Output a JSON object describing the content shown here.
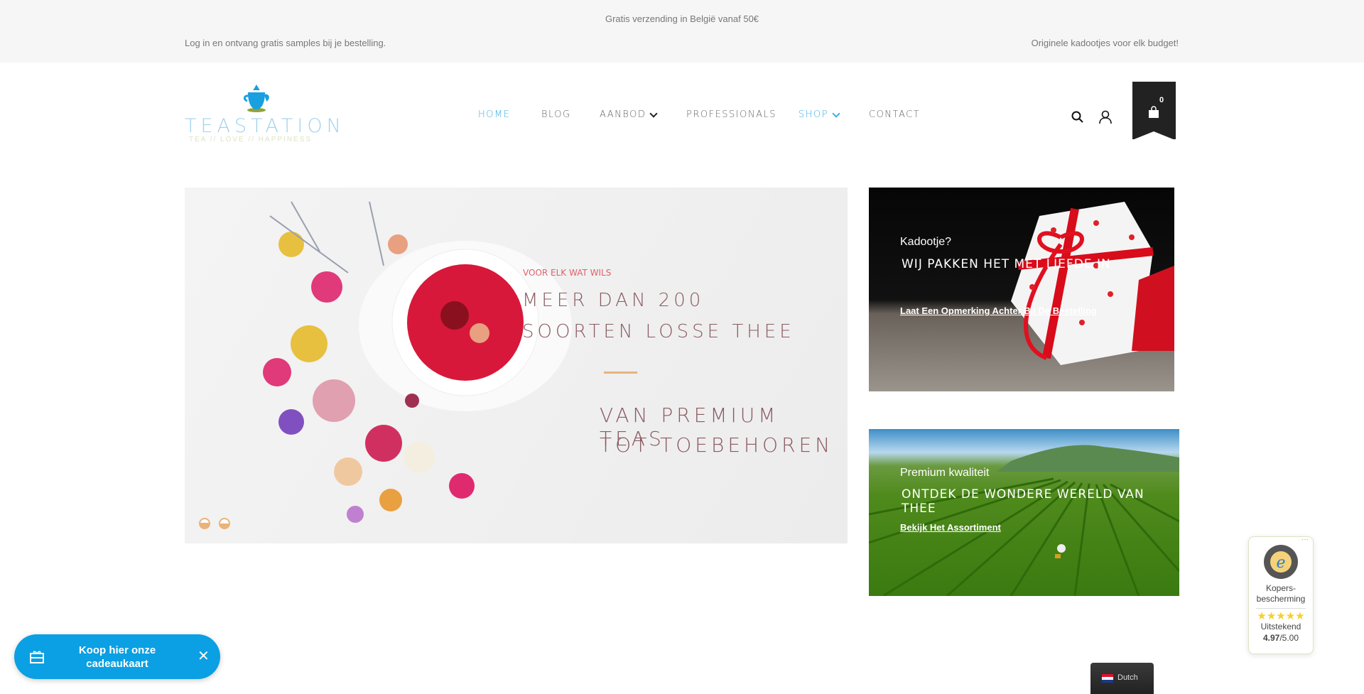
{
  "topbar": {
    "center": "Gratis verzending in België vanaf 50€",
    "left": "Log in en ontvang gratis samples bij je bestelling.",
    "right": "Originele kadootjes voor elk budget!"
  },
  "logo": {
    "title": "TEASTATION",
    "tagline": "TEA // LOVE // HAPPINESS"
  },
  "nav": [
    {
      "label": "HOME",
      "active": true
    },
    {
      "label": "BLOG"
    },
    {
      "label": "AANBOD",
      "dropdown": true
    },
    {
      "label": "PROFESSIONALS"
    },
    {
      "label": "SHOP",
      "dropdown": true
    },
    {
      "label": "CONTACT"
    }
  ],
  "header": {
    "cart_count": "0",
    "icons": [
      "search-icon",
      "user-icon",
      "shopping-bag-icon"
    ]
  },
  "hero": {
    "kicker": "VOOR ELK WAT WILS",
    "line1": "MEER DAN 200",
    "line2": "SOORTEN LOSSE THEE",
    "line3": "VAN PREMIUM TEAS",
    "line4": "TOT TOEBEHOREN",
    "slides": 2,
    "active_slide": 1,
    "accent": "#e9b37a"
  },
  "cards": [
    {
      "title": "Kadootje?",
      "subtitle": "WIJ PAKKEN HET MET LIEFDE IN",
      "link": "Laat Een Opmerking Achter Bij De Bestelling"
    },
    {
      "title": "Premium kwaliteit",
      "subtitle": "ONTDEK DE WONDERE WERELD VAN THEE",
      "link": "Bekijk Het Assortiment"
    }
  ],
  "giftcard": {
    "label": "Koop hier onze cadeaukaart",
    "color": "#0aa0e3"
  },
  "trust": {
    "label": "Kopers-bescherming",
    "rating_text": "Uitstekend",
    "score": "4.97",
    "max": "/5.00",
    "stars": 5
  },
  "language": {
    "label": "Dutch"
  }
}
